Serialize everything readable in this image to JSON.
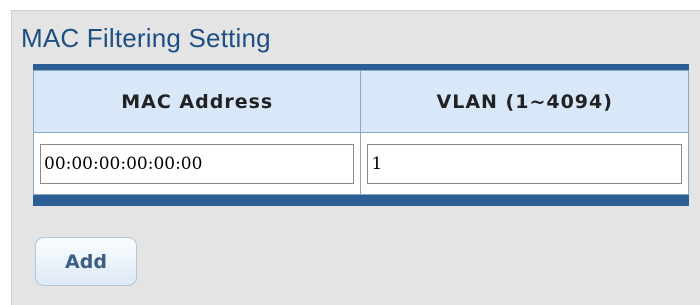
{
  "section": {
    "title": "MAC Filtering Setting"
  },
  "table": {
    "columns": [
      "MAC Address",
      "VLAN (1~4094)"
    ],
    "row": {
      "mac_address": "00:00:00:00:00:00",
      "vlan": "1"
    }
  },
  "actions": {
    "add_label": "Add"
  },
  "colors": {
    "title": "#1d4f85",
    "table_border": "#2d5f97",
    "header_bg": "#d8e8f8",
    "panel_bg": "#e4e4e4",
    "button_text": "#3b5f84"
  }
}
